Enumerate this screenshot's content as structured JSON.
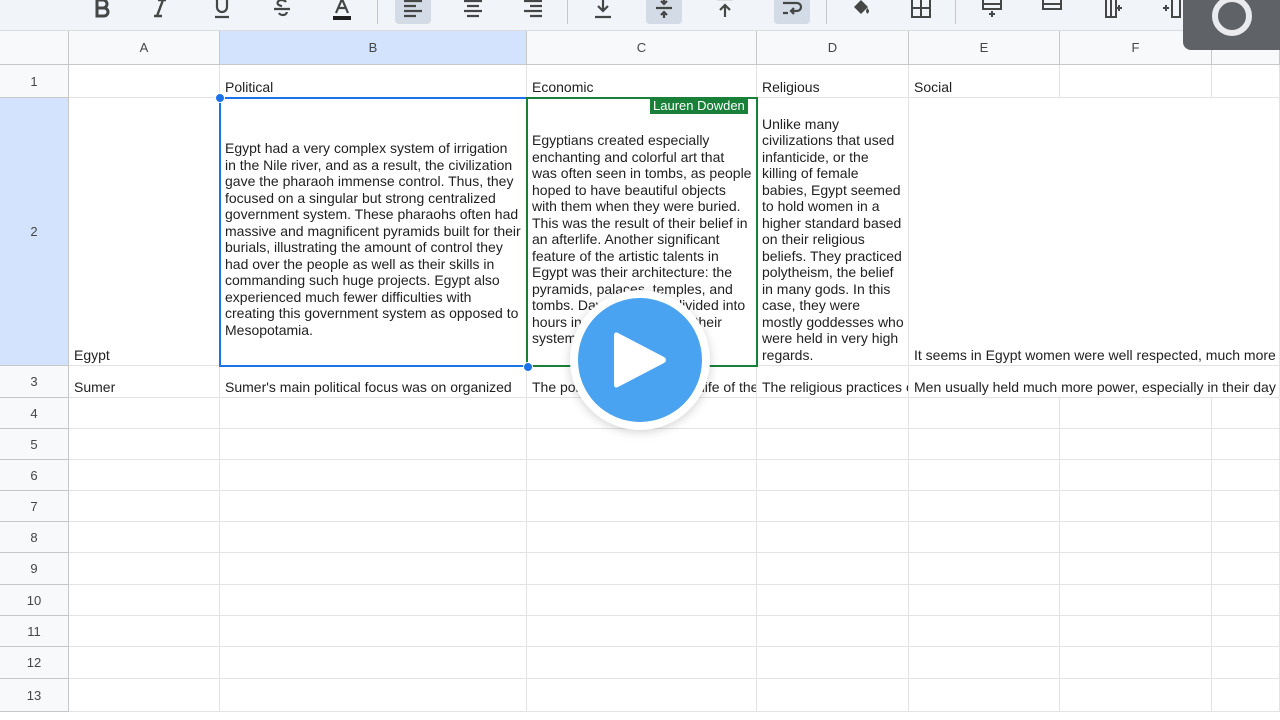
{
  "toolbar": {
    "icons": [
      "bold-icon",
      "italic-icon",
      "underline-icon",
      "strikethrough-icon",
      "text-color-icon",
      "align-left-icon",
      "align-center-icon",
      "align-right-icon",
      "valign-bottom-icon",
      "valign-middle-icon",
      "valign-top-icon",
      "text-wrap-icon",
      "fill-color-icon",
      "borders-icon",
      "insert-row-icon",
      "insert-column-icon",
      "insert-cells-icon"
    ],
    "colors": {
      "text_color_bar": "#1f1f1f",
      "active_bg": "#d3dbe6"
    }
  },
  "columns": [
    "A",
    "B",
    "C",
    "D",
    "E",
    "F"
  ],
  "rows": [
    "1",
    "2",
    "3",
    "4",
    "5",
    "6",
    "7",
    "8",
    "9",
    "10",
    "11",
    "12",
    "13"
  ],
  "cells": {
    "B1": "Political",
    "C1": "Economic",
    "D1": "Religious",
    "E1": "Social",
    "A2": "Egypt",
    "B2": "Egypt had a very complex system of irrigation in the Nile river, and as a result, the civilization gave the pharaoh immense control. Thus, they focused on a singular but strong centralized government system. These pharaohs often had massive and magnificent pyramids built for their burials, illustrating the amount of control they had over the people as well as their skills in commanding such huge projects. Egypt also experienced much fewer difficulties with creating this government system as opposed to Mesopotamia.",
    "C2": "Egyptians created especially enchanting and colorful art that was often seen in tombs, as people hoped to have beautiful objects with them when they were buried. This was the result of their belief in an afterlife. Another significant feature of the artistic talents in Egypt was their architecture: the pyramids, palaces, temples, and tombs. Days were first divided into hours in Egypt, as well as their system of mathematics.",
    "D2": "Unlike many civilizations that used infanticide, or the killing of female babies, Egypt seemed to hold women in a higher standard based on their religious beliefs. They practiced polytheism, the belief in many gods. In this case, they were mostly goddesses who were held in very high regards.",
    "E2": "It seems in Egypt women were well respected, much more",
    "A3": "Sumer",
    "B3": "Sumer's main political focus was on organized",
    "C3": "The political and economic life of the Sumerians",
    "D3": "The religious practices of",
    "E3": "Men usually held much more power, especially in their day"
  },
  "collaborator": {
    "name": "Lauren Dowden",
    "color": "#188038"
  },
  "selection": {
    "cell": "B2",
    "color": "#1a73e8"
  }
}
